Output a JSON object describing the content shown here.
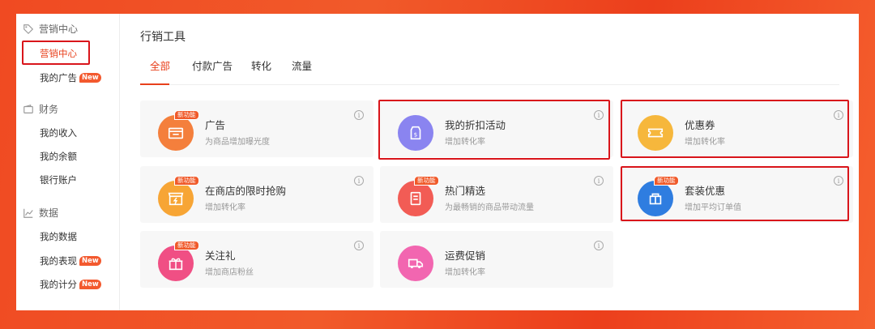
{
  "sidebar": {
    "sections": [
      {
        "label": "营销中心",
        "icon": "tag-icon",
        "items": [
          {
            "label": "营销中心",
            "active": true,
            "new": false
          },
          {
            "label": "我的广告",
            "active": false,
            "new": true
          }
        ]
      },
      {
        "label": "财务",
        "icon": "wallet-icon",
        "items": [
          {
            "label": "我的收入"
          },
          {
            "label": "我的余额"
          },
          {
            "label": "银行账户"
          }
        ]
      },
      {
        "label": "数据",
        "icon": "chart-line-icon",
        "items": [
          {
            "label": "我的数据"
          },
          {
            "label": "我的表现",
            "new": true
          },
          {
            "label": "我的计分",
            "new": true
          }
        ]
      }
    ],
    "new_badge": "New"
  },
  "main": {
    "title": "行销工具",
    "tabs": [
      {
        "label": "全部",
        "active": true
      },
      {
        "label": "付款广告"
      },
      {
        "label": "转化"
      },
      {
        "label": "流量"
      }
    ],
    "new_tag": "新功能",
    "cards": [
      {
        "title": "广告",
        "desc": "为商品增加曝光度",
        "color": "#f47f3c",
        "icon": "ad-icon",
        "new": true
      },
      {
        "title": "我的折扣活动",
        "desc": "增加转化率",
        "color": "#8a84f0",
        "icon": "discount-tag-icon",
        "new": false
      },
      {
        "title": "优惠券",
        "desc": "增加转化率",
        "color": "#f6b73c",
        "icon": "coupon-icon",
        "new": false
      },
      {
        "title": "在商店的限时抢购",
        "desc": "增加转化率",
        "color": "#f7a535",
        "icon": "flash-sale-icon",
        "new": true
      },
      {
        "title": "热门精选",
        "desc": "为最畅销的商品带动流量",
        "color": "#f25c55",
        "icon": "top-picks-icon",
        "new": true
      },
      {
        "title": "套装优惠",
        "desc": "增加平均订单值",
        "color": "#2f7de0",
        "icon": "bundle-icon",
        "new": true
      },
      {
        "title": "关注礼",
        "desc": "增加商店粉丝",
        "color": "#f04f84",
        "icon": "gift-icon",
        "new": true
      },
      {
        "title": "运费促销",
        "desc": "增加转化率",
        "color": "#f266b0",
        "icon": "truck-icon",
        "new": false
      }
    ]
  },
  "colors": {
    "accent": "#e8401c",
    "highlight": "#d9151b"
  }
}
